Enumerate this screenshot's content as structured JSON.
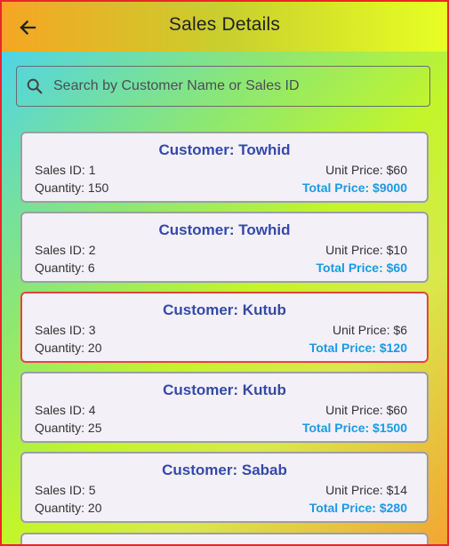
{
  "appbar": {
    "title": "Sales Details",
    "back_icon": "arrow-left-icon"
  },
  "search": {
    "placeholder": "Search by Customer Name or Sales ID",
    "value": "",
    "icon": "search-icon"
  },
  "colors": {
    "total": "#1b9ae6",
    "customer": "#3549a8",
    "selected_border": "#e64245"
  },
  "sales": [
    {
      "customer": "Customer: Towhid",
      "sales_id": "Sales ID: 1",
      "quantity": "Quantity: 150",
      "unit_price": "Unit Price: $60",
      "total": "Total Price: $9000"
    },
    {
      "customer": "Customer: Towhid",
      "sales_id": "Sales ID: 2",
      "quantity": "Quantity: 6",
      "unit_price": "Unit Price: $10",
      "total": "Total Price: $60"
    },
    {
      "customer": "Customer: Kutub",
      "sales_id": "Sales ID: 3",
      "quantity": "Quantity: 20",
      "unit_price": "Unit Price: $6",
      "total": "Total Price: $120",
      "selected": true
    },
    {
      "customer": "Customer: Kutub",
      "sales_id": "Sales ID: 4",
      "quantity": "Quantity: 25",
      "unit_price": "Unit Price: $60",
      "total": "Total Price: $1500"
    },
    {
      "customer": "Customer: Sabab",
      "sales_id": "Sales ID: 5",
      "quantity": "Quantity: 20",
      "unit_price": "Unit Price: $14",
      "total": "Total Price: $280"
    }
  ]
}
